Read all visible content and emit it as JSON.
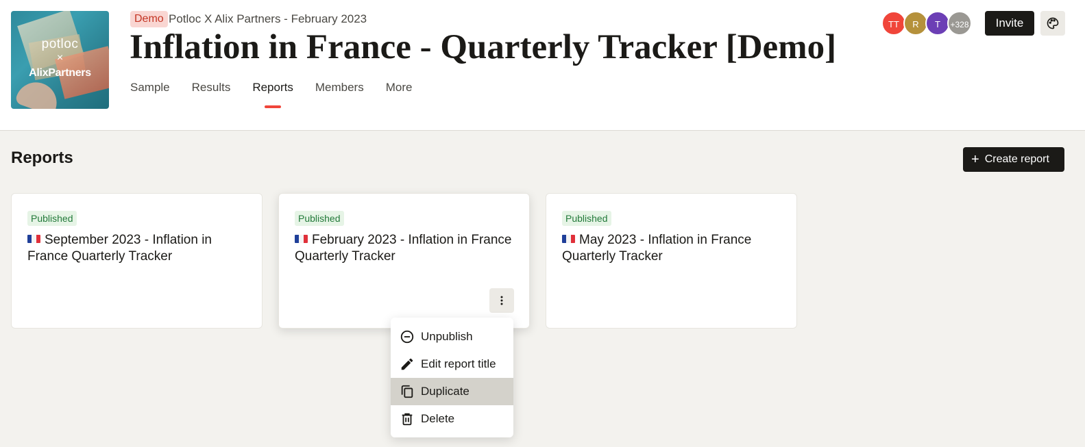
{
  "header": {
    "cover": {
      "brand_top": "potloc",
      "brand_x": "×",
      "brand_bottom": "AlixPartners"
    },
    "badge": "Demo",
    "subtitle": "Potloc X Alix Partners - February 2023",
    "title": "Inflation in France - Quarterly Tracker [Demo]",
    "tabs": [
      {
        "label": "Sample",
        "active": false
      },
      {
        "label": "Results",
        "active": false
      },
      {
        "label": "Reports",
        "active": true
      },
      {
        "label": "Members",
        "active": false
      },
      {
        "label": "More",
        "active": false
      }
    ],
    "avatars": [
      {
        "initials": "TT",
        "color": "#f0453a"
      },
      {
        "initials": "R",
        "color": "#b5913b"
      },
      {
        "initials": "T",
        "color": "#6c3fb5"
      },
      {
        "initials": "+328",
        "color": "#9a9893"
      }
    ],
    "invite_label": "Invite",
    "palette_icon": "palette-icon"
  },
  "main": {
    "section_title": "Reports",
    "create_label": "Create report",
    "cards": [
      {
        "status": "Published",
        "flag": "fr-flag-icon",
        "title": "September 2023 - Inflation in France Quarterly Tracker"
      },
      {
        "status": "Published",
        "flag": "fr-flag-icon",
        "title": "February 2023 - Inflation in France Quarterly Tracker"
      },
      {
        "status": "Published",
        "flag": "fr-flag-icon",
        "title": "May 2023 - Inflation in France Quarterly Tracker"
      }
    ],
    "menu": {
      "items": [
        {
          "label": "Unpublish",
          "icon": "minus-circle-icon"
        },
        {
          "label": "Edit report title",
          "icon": "pencil-icon"
        },
        {
          "label": "Duplicate",
          "icon": "copy-icon",
          "hovered": true
        },
        {
          "label": "Delete",
          "icon": "trash-icon"
        }
      ]
    }
  },
  "colors": {
    "accent": "#f0453a",
    "dark": "#1b1a17",
    "background": "#f3f2ee",
    "published_text": "#237a3a",
    "published_bg": "#e6f4e6",
    "demo_text": "#c43524",
    "demo_bg": "#f9d6d2"
  }
}
